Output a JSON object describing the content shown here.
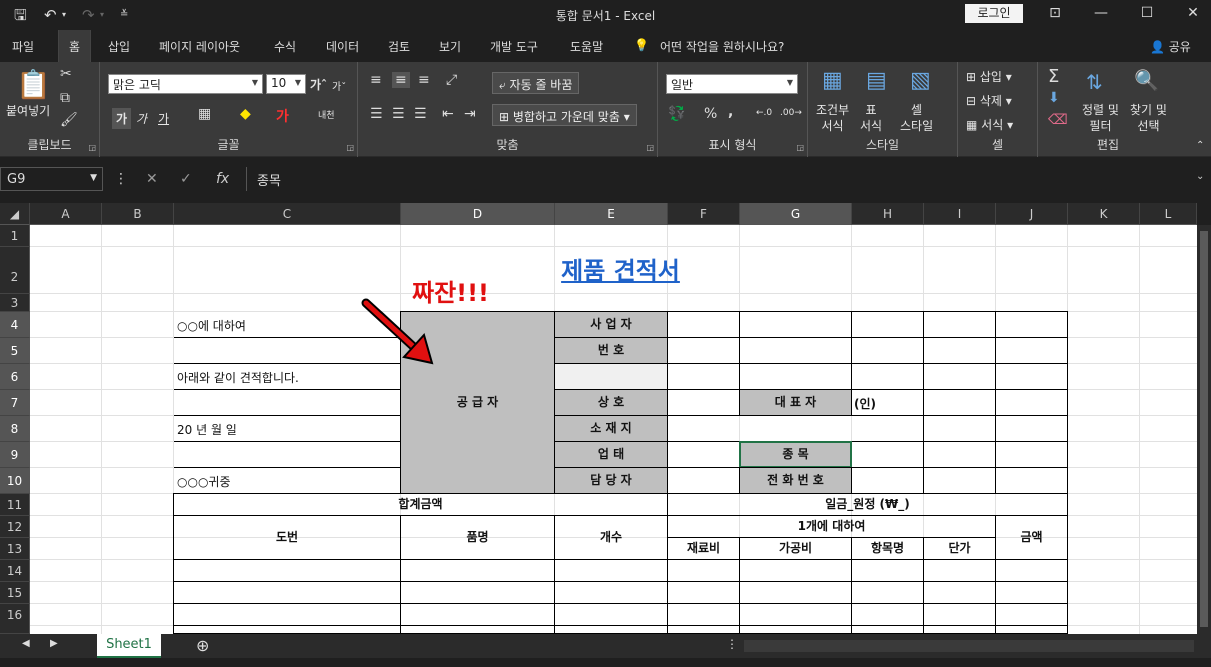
{
  "window": {
    "title": "통합 문서1  -  Excel",
    "login_label": "로그인"
  },
  "tabs": [
    "파일",
    "홈",
    "삽입",
    "페이지 레이아웃",
    "수식",
    "데이터",
    "검토",
    "보기",
    "개발 도구",
    "도움말"
  ],
  "active_tab": "홈",
  "tell_me": "어떤 작업을 원하시나요?",
  "share_label": "공유",
  "ribbon": {
    "clipboard": {
      "paste": "붙여넣기",
      "label": "클립보드"
    },
    "font": {
      "name": "맑은 고딕",
      "size": "10",
      "label": "글꼴",
      "bold": "가",
      "italic": "가",
      "underline": "가",
      "phonetic": "내천"
    },
    "align": {
      "wrap": "자동 줄 바꿈",
      "merge": "병합하고 가운데 맞춤",
      "label": "맞춤"
    },
    "number": {
      "format": "일반",
      "label": "표시 형식"
    },
    "styles": {
      "conditional": "조건부\n서식",
      "table": "표\n서식",
      "cell": "셀\n스타일",
      "label": "스타일"
    },
    "cells": {
      "insert": "삽입",
      "delete": "삭제",
      "format": "서식",
      "label": "셀"
    },
    "editing": {
      "sort": "정렬 및\n필터",
      "find": "찾기 및\n선택",
      "label": "편집"
    }
  },
  "formula_bar": {
    "name_box": "G9",
    "content": "종목"
  },
  "columns": [
    "A",
    "B",
    "C",
    "D",
    "E",
    "F",
    "G",
    "H",
    "I",
    "J",
    "K",
    "L"
  ],
  "rows": [
    "1",
    "2",
    "3",
    "4",
    "5",
    "6",
    "7",
    "8",
    "9",
    "10",
    "11",
    "12",
    "13",
    "14",
    "15",
    "16"
  ],
  "sheet": {
    "title": "제품 견적서",
    "annotation": "짜잔!!!",
    "c4": "○○에 대하여",
    "c6": "아래와 같이 견적합니다.",
    "c8": "20 년 월 일",
    "c10": "○○○귀중",
    "supplier": "공       급       자",
    "e4": "사   업   자",
    "e5": "번         호",
    "e7": "상         호",
    "e8": "소   재   지",
    "e9": "업         태",
    "e10": "담   당   자",
    "g7": "대   표   자",
    "h7": "(인)",
    "g9": "종         목",
    "g10": "전 화 번 호",
    "total_label": "합계금액",
    "total_value": "일금_원정 (₩_)",
    "h_dobeon": "도번",
    "h_pummyeong": "품명",
    "h_gaesu": "개수",
    "h_per1": "1개에 대하여",
    "h_jaeryo": "재료비",
    "h_gagong": "가공비",
    "h_hangmok": "항목명",
    "h_danga": "단가",
    "h_geumaek": "금액"
  },
  "sheet_tab": "Sheet1"
}
